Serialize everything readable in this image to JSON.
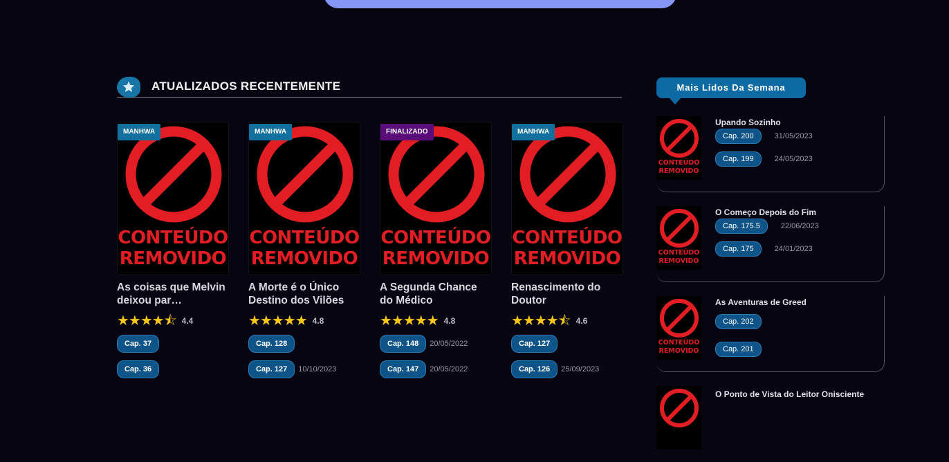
{
  "section": {
    "title": "ATUALIZADOS RECENTEMENTE"
  },
  "cover_text": {
    "line1": "CONTEÚDO",
    "line2": "REMOVIDO"
  },
  "cards": [
    {
      "type": "MANHWA",
      "title": "As coisas que Melvin deixou par…",
      "stars": "★★★★⯪",
      "rating": "4.4",
      "chapters": [
        {
          "label": "Cap. 37",
          "date": ""
        },
        {
          "label": "Cap. 36",
          "date": ""
        }
      ]
    },
    {
      "type": "MANHWA",
      "title": "A Morte é o Único Destino dos Vilões",
      "stars": "★★★★★",
      "rating": "4.8",
      "chapters": [
        {
          "label": "Cap. 128",
          "date": ""
        },
        {
          "label": "Cap. 127",
          "date": "10/10/2023"
        }
      ]
    },
    {
      "type": "FINALIZADO",
      "title": "A Segunda Chance do Médico",
      "stars": "★★★★★",
      "rating": "4.8",
      "chapters": [
        {
          "label": "Cap. 148",
          "date": "20/05/2022"
        },
        {
          "label": "Cap. 147",
          "date": "20/05/2022"
        }
      ]
    },
    {
      "type": "MANHWA",
      "title": "Renascimento do Doutor",
      "stars": "★★★★⯪",
      "rating": "4.6",
      "chapters": [
        {
          "label": "Cap. 127",
          "date": ""
        },
        {
          "label": "Cap. 126",
          "date": "25/09/2023"
        }
      ]
    }
  ],
  "sidebar": {
    "title": "Mais Lidos Da Semana",
    "items": [
      {
        "title": "Upando Sozinho",
        "chapters": [
          {
            "label": "Cap. 200",
            "date": "31/05/2023"
          },
          {
            "label": "Cap. 199",
            "date": "24/05/2023"
          }
        ]
      },
      {
        "title": "O Começo Depois do Fim",
        "chapters": [
          {
            "label": "Cap. 175.5",
            "date": "22/06/2023"
          },
          {
            "label": "Cap. 175",
            "date": "24/01/2023"
          }
        ]
      },
      {
        "title": "As Aventuras de Greed",
        "chapters": [
          {
            "label": "Cap. 202",
            "date": ""
          },
          {
            "label": "Cap. 201",
            "date": ""
          }
        ]
      },
      {
        "title": "O Ponto de Vista do Leitor Onisciente",
        "chapters": []
      }
    ]
  },
  "colors": {
    "badge_manhwa": "#11709d",
    "badge_finalizado": "#5a0c7a",
    "chapter_button": "#0e5488",
    "accent": "#0d6aa2"
  }
}
